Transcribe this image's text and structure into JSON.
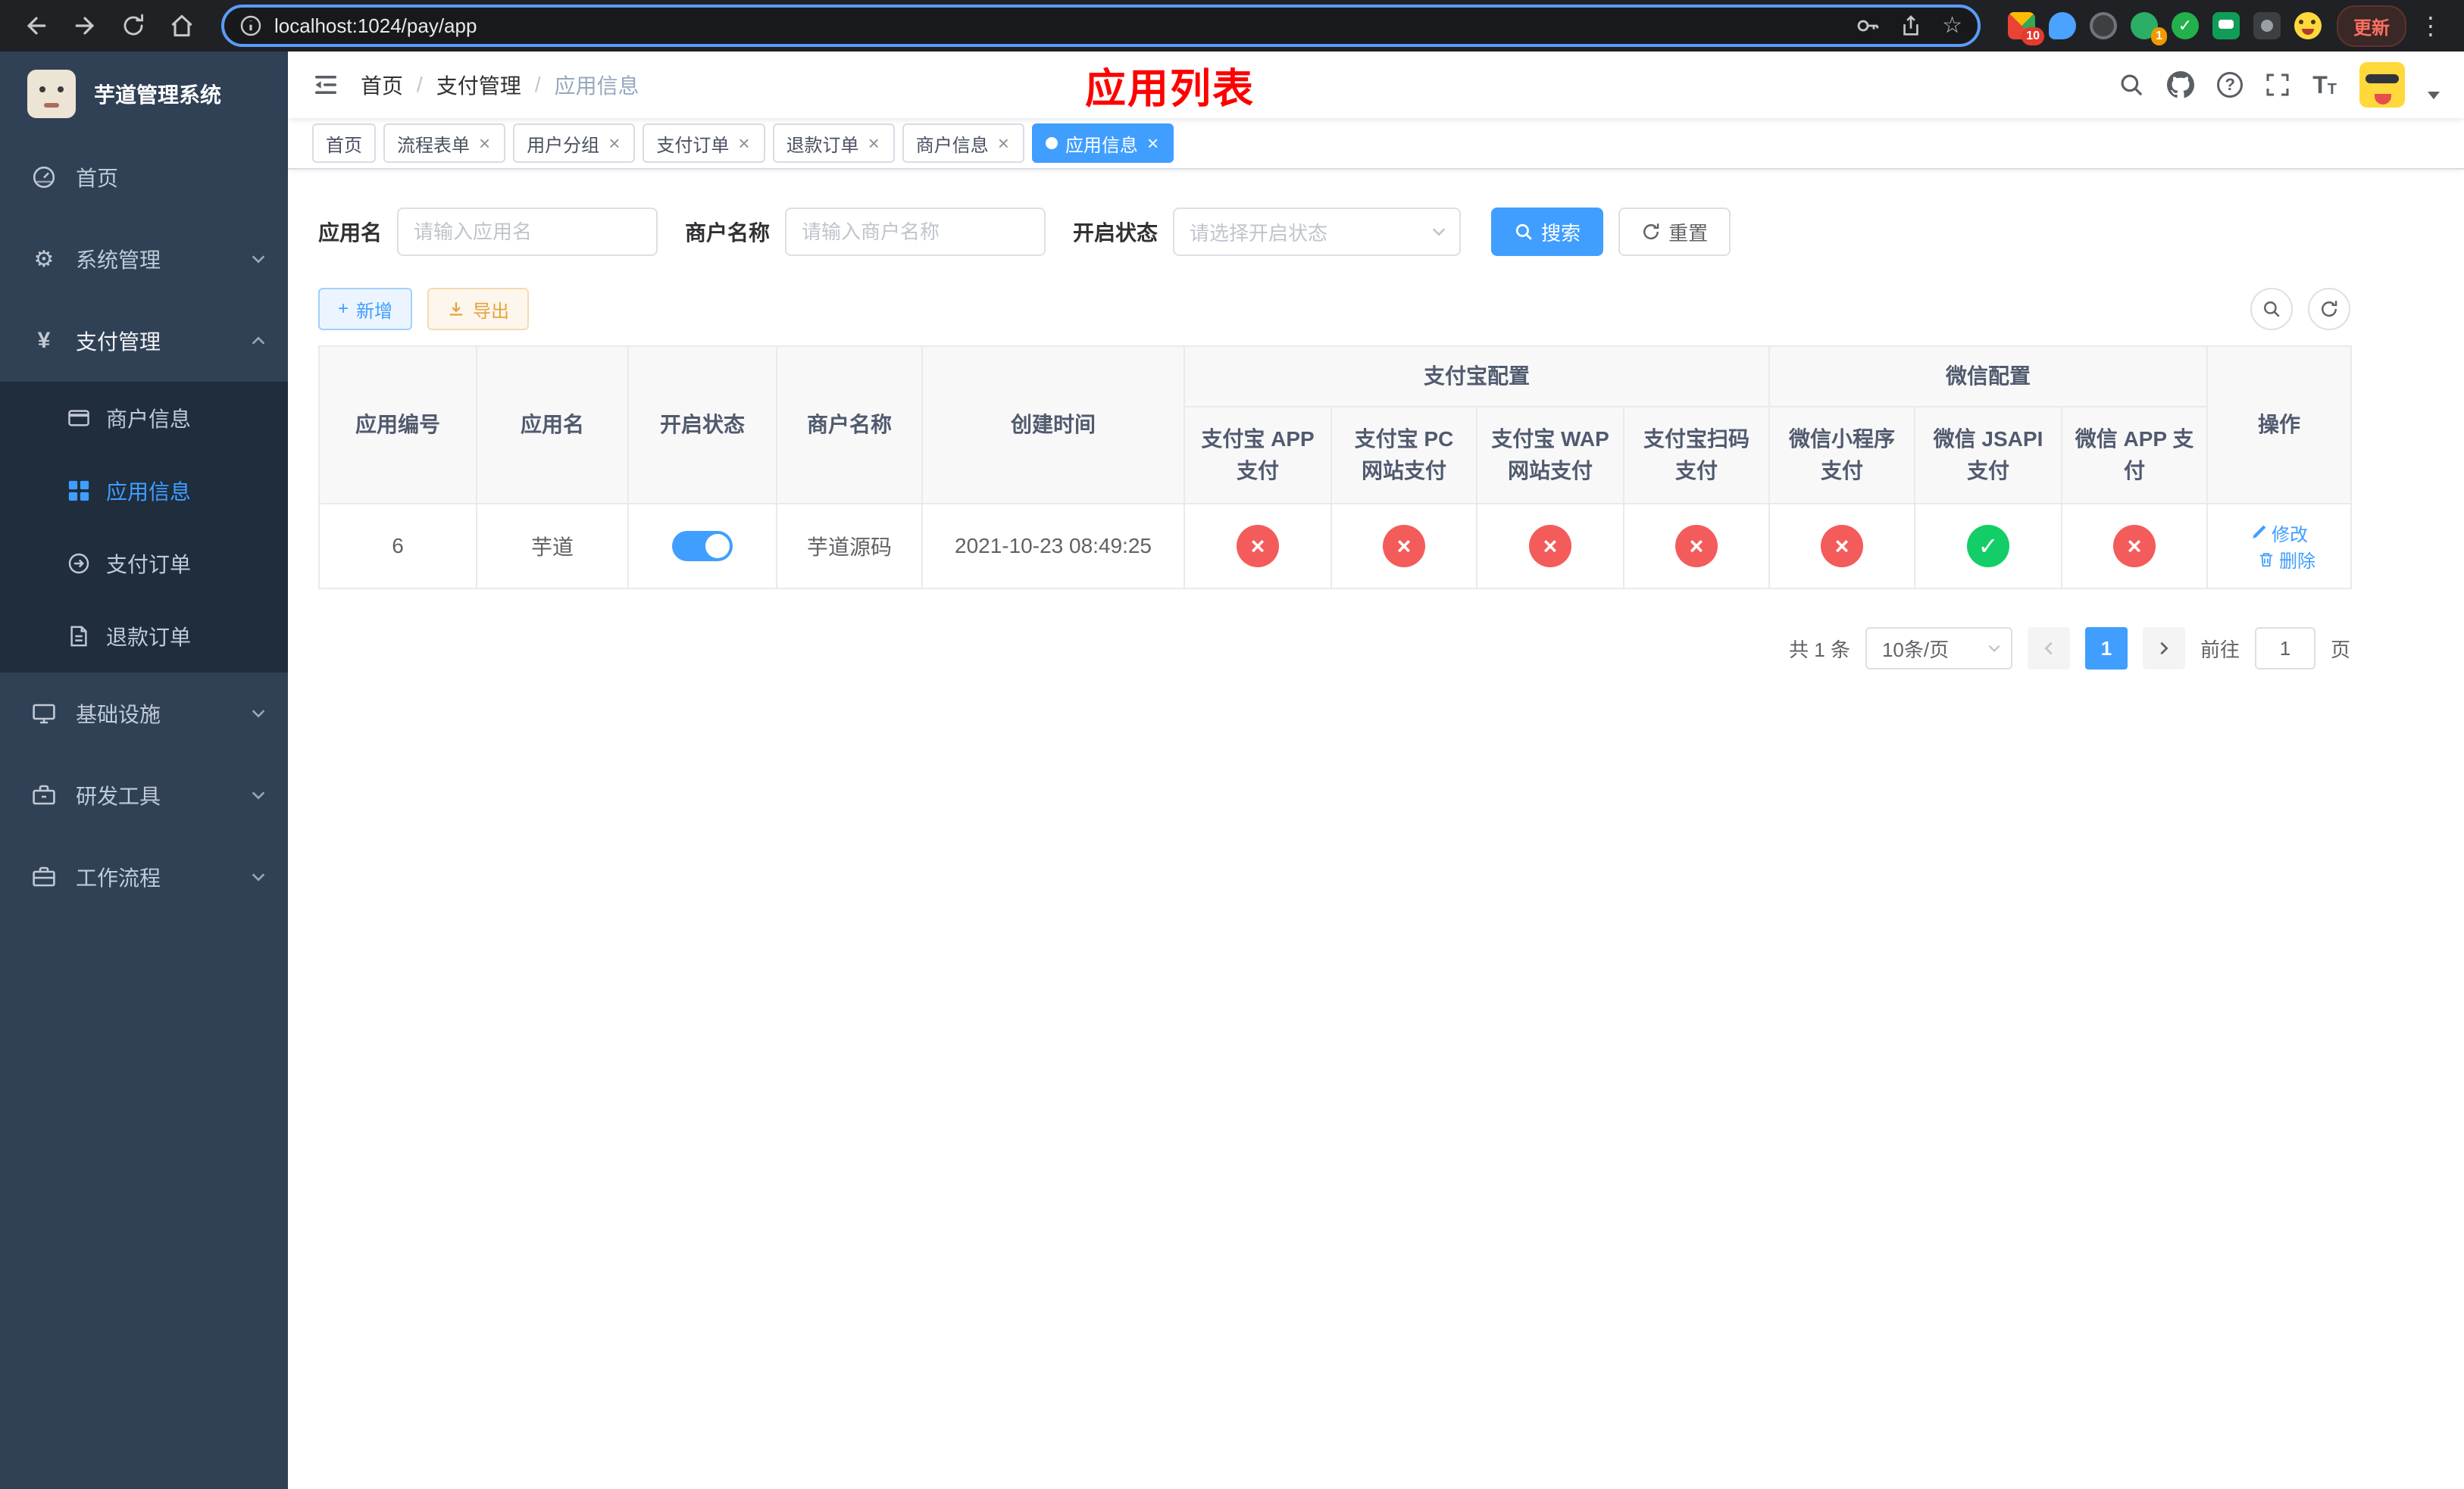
{
  "colors": {
    "primary": "#409eff",
    "danger": "#f45b5b",
    "success": "#13ce66",
    "page_title_red": "#ff0000",
    "sidebar_bg": "#304156",
    "submenu_bg": "#1f2d3d"
  },
  "browser": {
    "url": "localhost:1024/pay/app",
    "update_label": "更新",
    "menu_glyph": "⋮",
    "star_glyph": "☆",
    "extension_badge_grid": "10",
    "extension_badge_avatar": "1",
    "check_glyph": "✓"
  },
  "sidebar": {
    "title": "芋道管理系统",
    "menu": [
      {
        "label": "首页"
      },
      {
        "label": "系统管理",
        "glyph": "⚙"
      },
      {
        "label": "支付管理",
        "glyph": "¥"
      },
      {
        "label": "基础设施"
      },
      {
        "label": "研发工具"
      },
      {
        "label": "工作流程"
      }
    ],
    "pay_submenu": [
      {
        "label": "商户信息"
      },
      {
        "label": "应用信息"
      },
      {
        "label": "支付订单"
      },
      {
        "label": "退款订单"
      }
    ]
  },
  "navbar": {
    "breadcrumb": [
      "首页",
      "支付管理",
      "应用信息"
    ],
    "separator": "/",
    "page_title": "应用列表",
    "help_glyph": "?",
    "font_glyph": "T"
  },
  "tabbar": {
    "close_glyph": "×",
    "tabs": [
      {
        "label": "首页"
      },
      {
        "label": "流程表单"
      },
      {
        "label": "用户分组"
      },
      {
        "label": "支付订单"
      },
      {
        "label": "退款订单"
      },
      {
        "label": "商户信息"
      },
      {
        "label": "应用信息"
      }
    ]
  },
  "filters": {
    "app_name_label": "应用名",
    "app_name_placeholder": "请输入应用名",
    "merchant_label": "商户名称",
    "merchant_placeholder": "请输入商户名称",
    "status_label": "开启状态",
    "status_placeholder": "请选择开启状态",
    "search_label": "搜索",
    "reset_label": "重置"
  },
  "toolbar": {
    "add_glyph": "+",
    "add_label": "新增",
    "export_label": "导出"
  },
  "table": {
    "groups": {
      "alipay": "支付宝配置",
      "wechat": "微信配置"
    },
    "columns": {
      "app_id": "应用编号",
      "app_name": "应用名",
      "status": "开启状态",
      "merchant": "商户名称",
      "created": "创建时间",
      "alipay_app": "支付宝 APP 支付",
      "alipay_pc": "支付宝 PC 网站支付",
      "alipay_wap": "支付宝 WAP 网站支付",
      "alipay_qr": "支付宝扫码支付",
      "wx_mini": "微信小程序支付",
      "wx_jsapi": "微信 JSAPI 支付",
      "wx_app": "微信 APP 支付",
      "action": "操作"
    },
    "row": {
      "app_id": "6",
      "app_name": "芋道",
      "enabled": "on",
      "merchant": "芋道源码",
      "created": "2021-10-23 08:49:25",
      "states": {
        "alipay_app": {
          "glyph": "×",
          "state": "fail"
        },
        "alipay_pc": {
          "glyph": "×",
          "state": "fail"
        },
        "alipay_wap": {
          "glyph": "×",
          "state": "fail"
        },
        "alipay_qr": {
          "glyph": "×",
          "state": "fail"
        },
        "wx_mini": {
          "glyph": "×",
          "state": "fail"
        },
        "wx_jsapi": {
          "glyph": "✓",
          "state": "ok"
        },
        "wx_app": {
          "glyph": "×",
          "state": "fail"
        }
      },
      "edit_label": "修改",
      "delete_label": "删除"
    }
  },
  "pagination": {
    "total_text": "共 1 条",
    "page_size": "10条/页",
    "current_page": "1",
    "goto_label": "前往",
    "goto_value": "1",
    "unit_label": "页"
  }
}
